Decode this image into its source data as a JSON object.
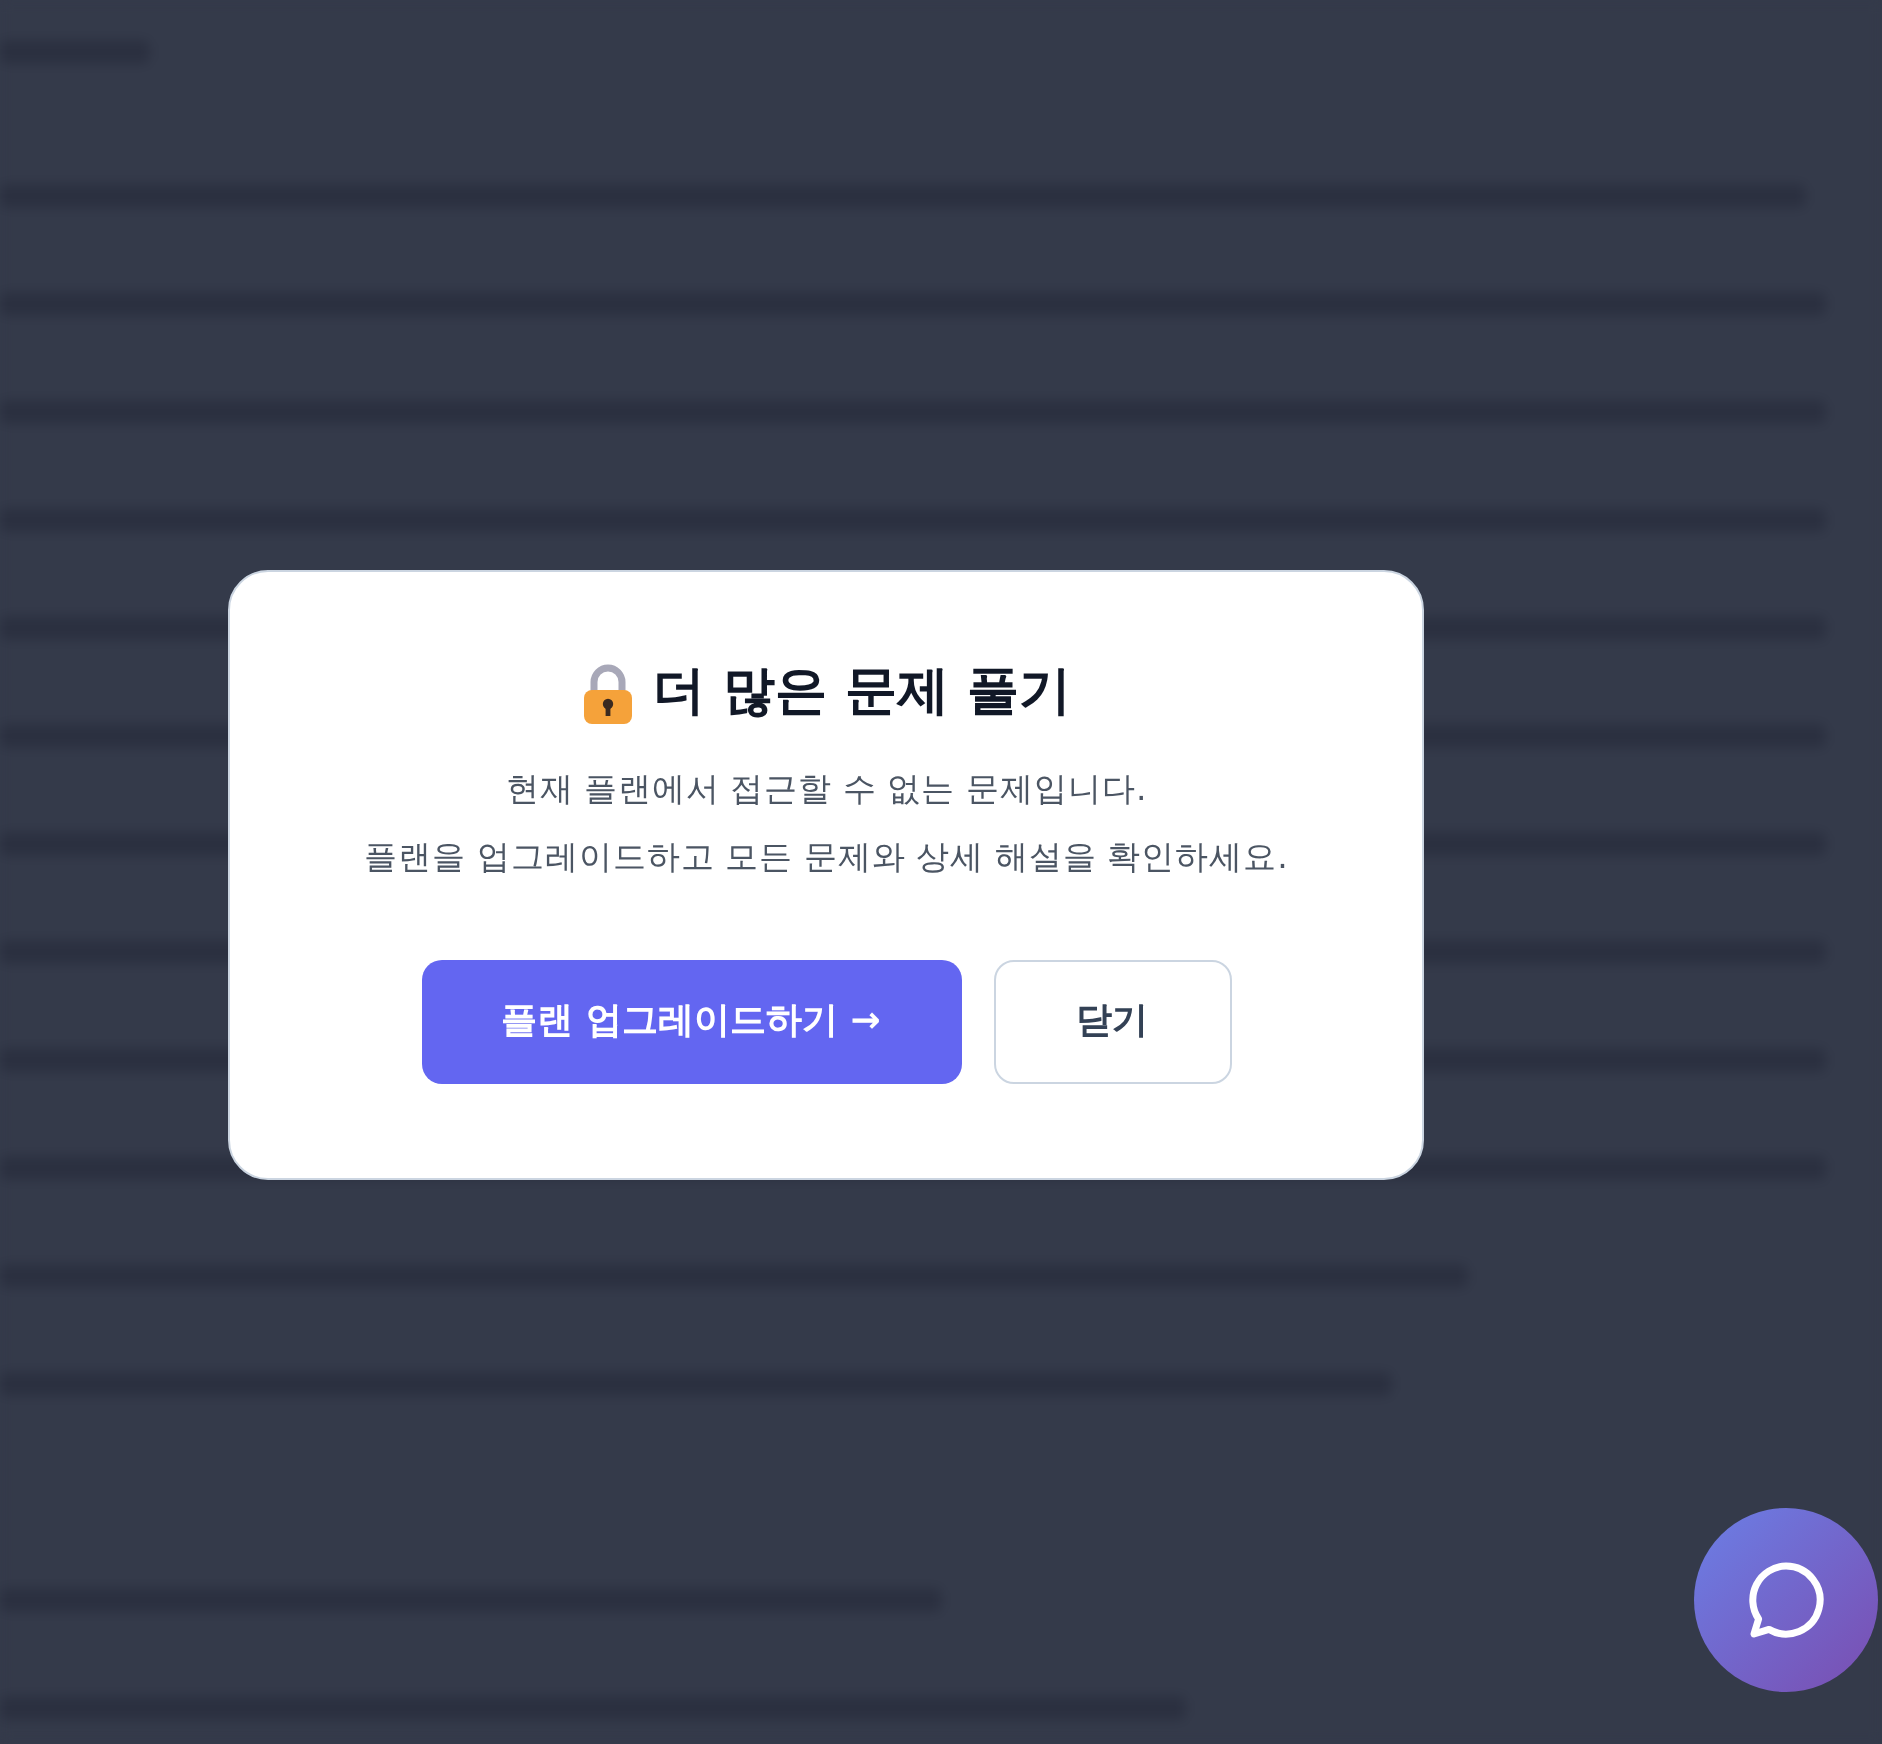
{
  "modal": {
    "title": "더 많은 문제 풀기",
    "message_lines": [
      "현재 플랜에서 접근할 수 없는 문제입니다.",
      "플랜을 업그레이드하고 모든 문제와 상세 해설을 확인하세요."
    ],
    "buttons": [
      {
        "kind": "primary",
        "label": "플랜 업그레이드하기 →"
      },
      {
        "kind": "secondary",
        "label": "닫기"
      }
    ]
  }
}
